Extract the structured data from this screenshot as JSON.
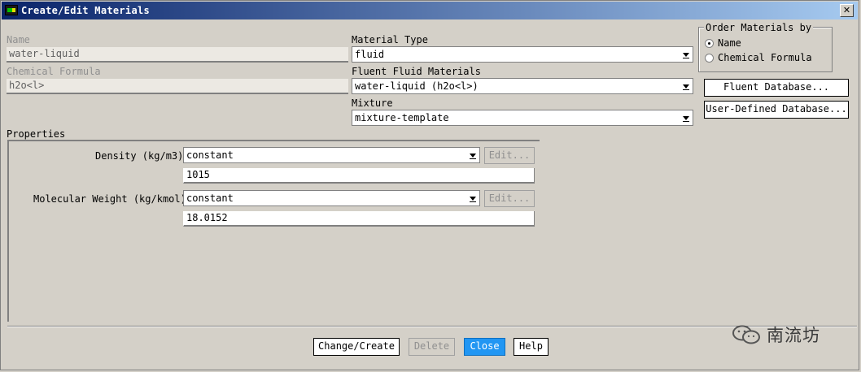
{
  "window": {
    "title": "Create/Edit Materials",
    "close_glyph": "✕"
  },
  "name": {
    "label": "Name",
    "value": "water-liquid"
  },
  "chemical_formula": {
    "label": "Chemical Formula",
    "value": "h2o<l>"
  },
  "material_type": {
    "label": "Material Type",
    "value": "fluid"
  },
  "fluent_fluid_materials": {
    "label": "Fluent Fluid Materials",
    "value": "water-liquid (h2o<l>)"
  },
  "mixture": {
    "label": "Mixture",
    "value": "mixture-template"
  },
  "order_by": {
    "label": "Order Materials by",
    "options": [
      {
        "label": "Name",
        "selected": true
      },
      {
        "label": "Chemical Formula",
        "selected": false
      }
    ]
  },
  "database_buttons": {
    "fluent": "Fluent Database...",
    "user_defined": "User-Defined Database..."
  },
  "properties": {
    "label": "Properties",
    "density": {
      "label": "Density (kg/m3)",
      "method": "constant",
      "value": "1015",
      "edit": "Edit..."
    },
    "molecular_weight": {
      "label": "Molecular Weight (kg/kmol)",
      "method": "constant",
      "value": "18.0152",
      "edit": "Edit..."
    }
  },
  "actions": {
    "change_create": "Change/Create",
    "delete": "Delete",
    "close": "Close",
    "help": "Help"
  },
  "watermark": {
    "text": "南流坊"
  },
  "colors": {
    "close_accent": "#2196f3",
    "title_start": "#0a246a",
    "title_end": "#a6caf0"
  }
}
